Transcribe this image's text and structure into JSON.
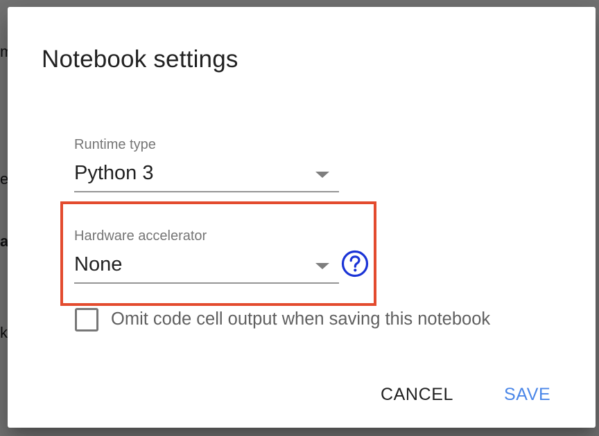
{
  "background_fragments": {
    "frag1": "m",
    "frag2": "e",
    "frag3": "a",
    "frag4": "k"
  },
  "dialog": {
    "title": "Notebook settings",
    "runtime_type": {
      "label": "Runtime type",
      "value": "Python 3"
    },
    "hardware_accelerator": {
      "label": "Hardware accelerator",
      "value": "None"
    },
    "help_icon": "help-circle-icon",
    "omit_output_checkbox": {
      "label": "Omit code cell output when saving this notebook",
      "checked": false
    },
    "buttons": {
      "cancel": "CANCEL",
      "save": "SAVE"
    }
  },
  "colors": {
    "highlight_border": "#e34b2e",
    "help_icon": "#1a33d6",
    "save_button": "#4a86e8"
  }
}
